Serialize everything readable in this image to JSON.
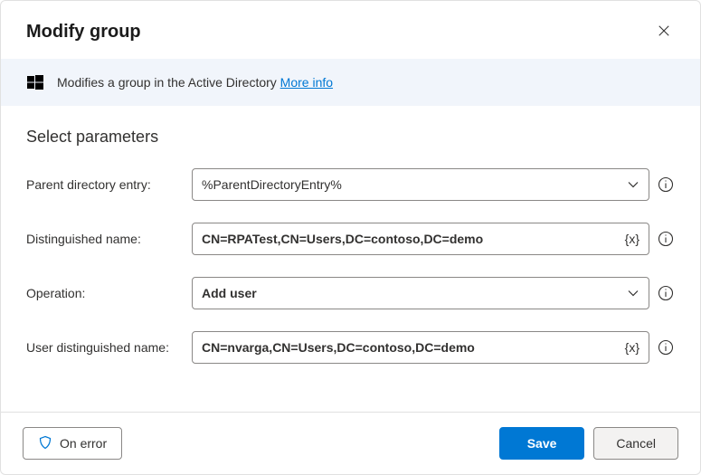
{
  "header": {
    "title": "Modify group"
  },
  "banner": {
    "text": "Modifies a group in the Active Directory ",
    "link_text": "More info"
  },
  "form": {
    "section_heading": "Select parameters",
    "rows": [
      {
        "label": "Parent directory entry:",
        "value": "%ParentDirectoryEntry%",
        "type": "select"
      },
      {
        "label": "Distinguished name:",
        "value": "CN=RPATest,CN=Users,DC=contoso,DC=demo",
        "type": "text"
      },
      {
        "label": "Operation:",
        "value": "Add user",
        "type": "select"
      },
      {
        "label": "User distinguished name:",
        "value": "CN=nvarga,CN=Users,DC=contoso,DC=demo",
        "type": "text"
      }
    ]
  },
  "footer": {
    "on_error": "On error",
    "save": "Save",
    "cancel": "Cancel"
  },
  "colors": {
    "accent": "#0078d4",
    "banner_bg": "#f1f5fb"
  }
}
